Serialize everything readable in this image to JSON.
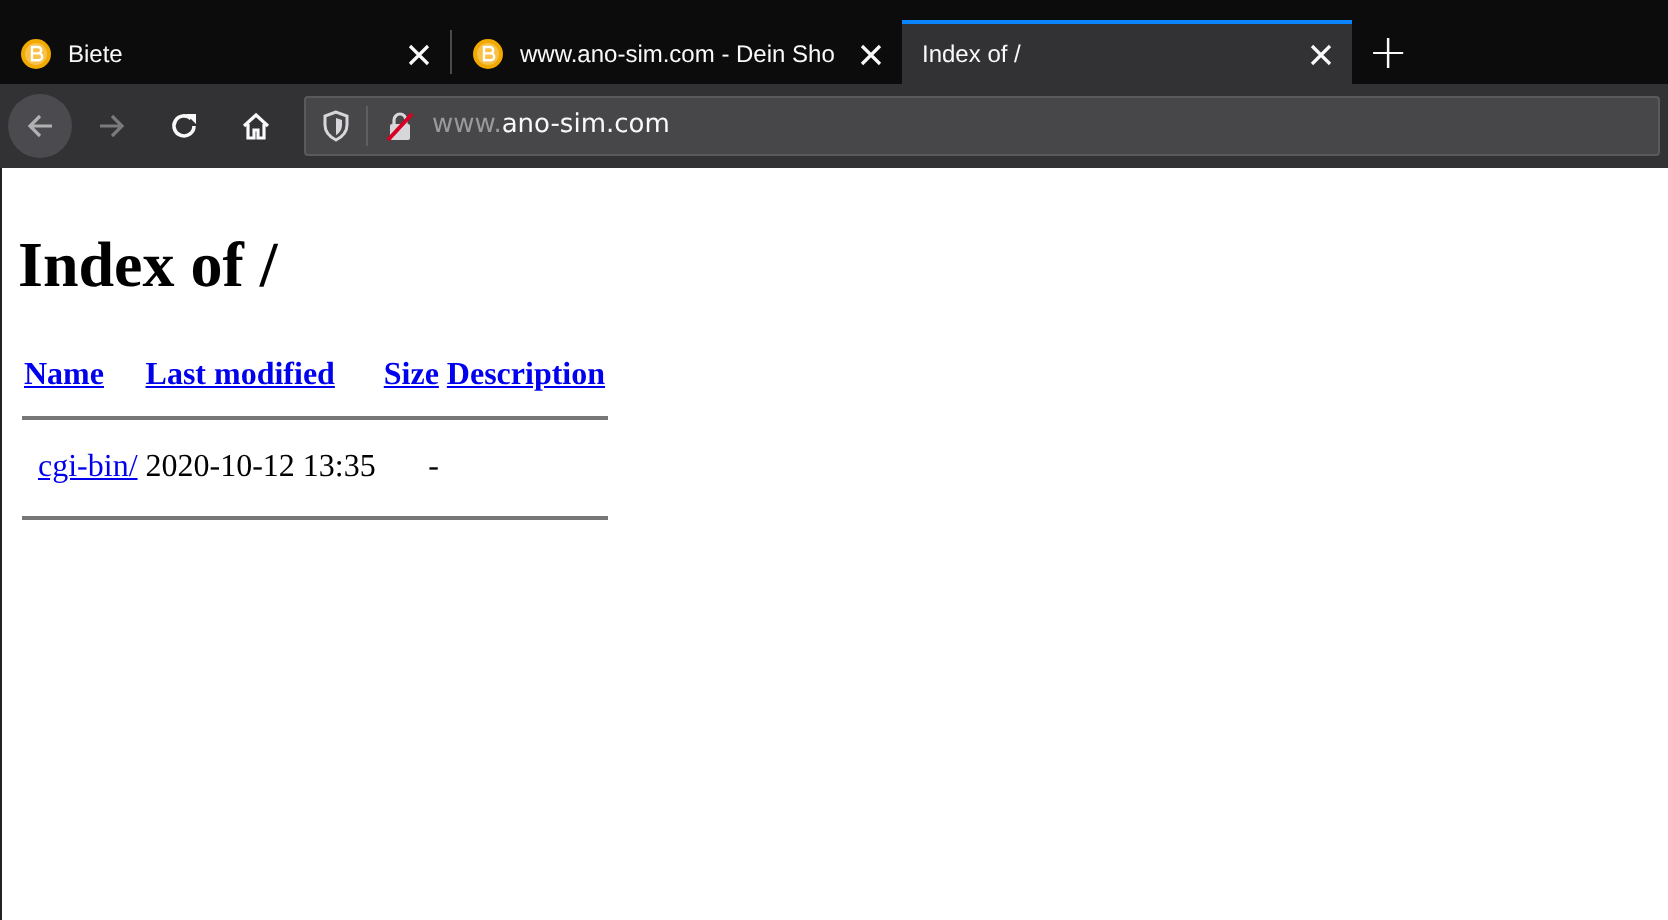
{
  "tabs": [
    {
      "title": "Biete",
      "favicon": true,
      "selected": false
    },
    {
      "title": "www.ano-sim.com - Dein Sho",
      "favicon": true,
      "selected": false
    },
    {
      "title": "Index of /",
      "favicon": false,
      "selected": true
    }
  ],
  "new_tab": "+",
  "address_bar": {
    "url_prefix": "www.",
    "url_domain": "ano-sim.com",
    "back_disabled": false,
    "forward_disabled": true
  },
  "page": {
    "heading": "Index of /",
    "table": {
      "columns": [
        "Name",
        "Last modified",
        "Size",
        "Description"
      ],
      "rows": [
        {
          "name": "cgi-bin/",
          "modified": "2020-10-12 13:35",
          "size": "-"
        }
      ]
    }
  }
}
